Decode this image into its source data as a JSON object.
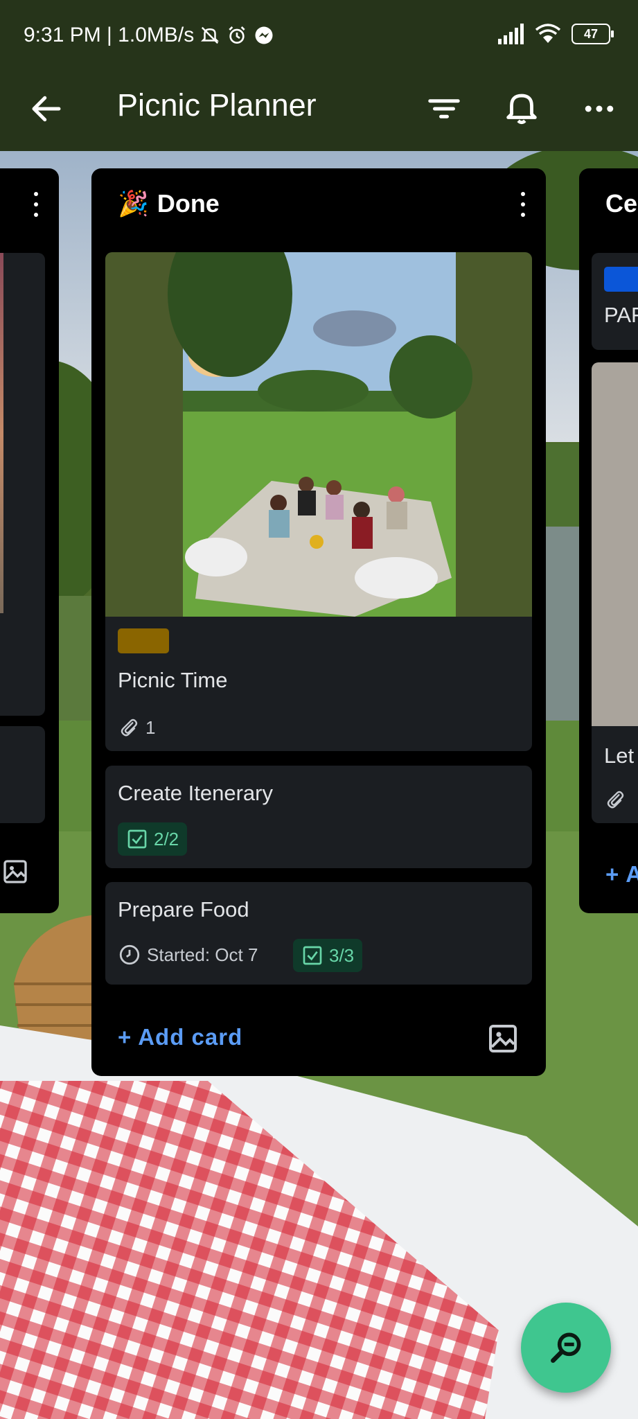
{
  "status_bar": {
    "time_speed": "9:31 PM | 1.0MB/s",
    "battery": "47",
    "icons": [
      "mute-bell-icon",
      "alarm-icon",
      "messenger-icon",
      "signal-icon",
      "wifi-icon",
      "battery-icon"
    ]
  },
  "app_bar": {
    "title": "Picnic Planner",
    "icons": [
      "back-arrow-icon",
      "filter-icon",
      "bell-icon",
      "more-icon"
    ]
  },
  "lists": {
    "main": {
      "emoji": "🎉",
      "title": "Done",
      "cards": [
        {
          "title": "Picnic Time",
          "label_color": "#8a6500",
          "attachments": "1"
        },
        {
          "title": "Create Itenerary",
          "checklist": "2/2"
        },
        {
          "title": "Prepare Food",
          "started": "Started: Oct 7",
          "checklist": "3/3"
        }
      ],
      "add_card": "+ Add card"
    },
    "right": {
      "title": "Ce",
      "cards": [
        {
          "title": "PAF",
          "label_color": "#0b56d8"
        },
        {
          "title": "Let"
        }
      ],
      "add_card": "+ A"
    }
  },
  "colors": {
    "app_bar": "#26341a",
    "card": "#1b1e22",
    "accent_link": "#5b9cf5",
    "checklist_complete": "#68d6a8",
    "fab": "#3fc68f"
  }
}
